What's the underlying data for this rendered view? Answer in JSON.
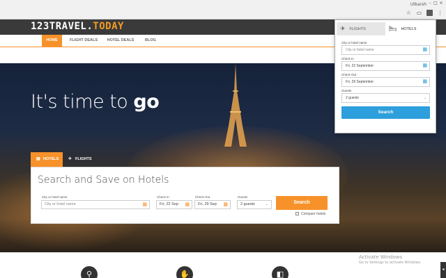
{
  "browser": {
    "user_label": "Utkarsh",
    "window_controls": [
      "–",
      "□",
      "×"
    ],
    "toolbar_icons": [
      "bookmark-star-icon",
      "cast-icon",
      "extension-icon",
      "menu-icon"
    ]
  },
  "site": {
    "logo_part1": "123TRAVEL.",
    "logo_part2": "TODAY",
    "nav": [
      {
        "label": "HOME",
        "active": true
      },
      {
        "label": "FLIGHT DEALS",
        "active": false
      },
      {
        "label": "HOTEL DEALS",
        "active": false
      },
      {
        "label": "BLOG",
        "active": false
      }
    ],
    "accent_color": "#f7922a"
  },
  "hero": {
    "title_light": "It's time to ",
    "title_bold": "go"
  },
  "search": {
    "tabs": [
      {
        "label": "HOTELS",
        "icon": "hotel-icon",
        "active": true
      },
      {
        "label": "FLIGHTS",
        "icon": "plane-icon",
        "active": false
      }
    ],
    "title": "Search and Save on Hotels",
    "city_label": "City or hotel name",
    "city_placeholder": "City or hotel name",
    "checkin_label": "Check In",
    "checkin_value": "Fri, 22 Sep",
    "checkout_label": "Check Out",
    "checkout_value": "Fri, 29 Sep",
    "guests_label": "Guests",
    "guests_value": "2 guests",
    "button": "Search",
    "compare_label": "Compare hotels"
  },
  "watermark": {
    "title": "Activate Windows",
    "subtitle": "Go to Settings to activate Windows."
  },
  "popup": {
    "tabs": [
      {
        "label": "FLIGHTS",
        "icon": "plane-icon",
        "active": false
      },
      {
        "label": "HOTELS",
        "icon": "bed-icon",
        "active": true
      }
    ],
    "city_label": "City or hotel name",
    "city_placeholder": "City or hotel name",
    "checkin_label": "Check In",
    "checkin_value": "Fri, 22 September",
    "checkout_label": "Check Out",
    "checkout_value": "Fri, 29 September",
    "guests_label": "Guests",
    "guests_value": "2 guests",
    "button": "Search",
    "button_color": "#2d9fdc"
  }
}
